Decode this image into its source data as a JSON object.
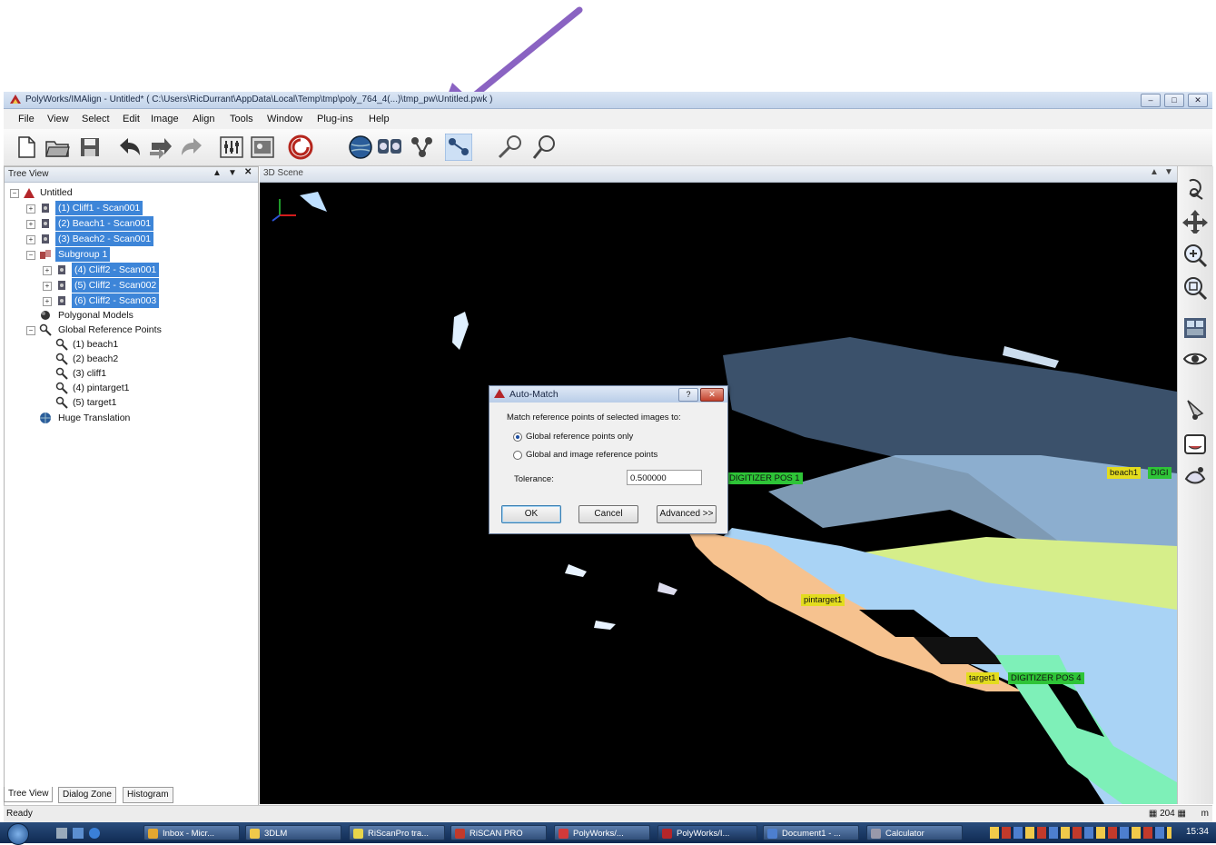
{
  "window": {
    "title": "PolyWorks/IMAlign - Untitled* ( C:\\Users\\RicDurrant\\AppData\\Local\\Temp\\tmp\\poly_764_4(...)\\tmp_pw\\Untitled.pwk )",
    "minimize": "–",
    "maximize": "□",
    "close": "✕"
  },
  "menu": [
    "File",
    "View",
    "Select",
    "Edit",
    "Image",
    "Align",
    "Tools",
    "Window",
    "Plug-ins",
    "Help"
  ],
  "tree_view": {
    "header": "Tree View",
    "root": "Untitled",
    "items": [
      {
        "label": "(1) Cliff1 - Scan001",
        "selected": true
      },
      {
        "label": "(2) Beach1 - Scan001",
        "selected": true
      },
      {
        "label": "(3) Beach2 - Scan001",
        "selected": true
      },
      {
        "label": "Subgroup 1",
        "selected": true
      },
      {
        "label": "(4) Cliff2 - Scan001",
        "selected": true
      },
      {
        "label": "(5) Cliff2 - Scan002",
        "selected": true
      },
      {
        "label": "(6) Cliff2 - Scan003",
        "selected": true
      },
      {
        "label": "Polygonal Models",
        "selected": false
      },
      {
        "label": "Global Reference Points",
        "selected": false
      },
      {
        "label": "(1) beach1",
        "selected": false
      },
      {
        "label": "(2) beach2",
        "selected": false
      },
      {
        "label": "(3) cliff1",
        "selected": false
      },
      {
        "label": "(4) pintarget1",
        "selected": false
      },
      {
        "label": "(5) target1",
        "selected": false
      },
      {
        "label": "Huge Translation",
        "selected": false
      }
    ],
    "tabs": [
      "Tree View",
      "Dialog Zone",
      "Histogram"
    ]
  },
  "scene": {
    "header": "3D Scene",
    "tags": {
      "digitizer_pos1": "DIGITIZER POS 1",
      "beach1": "beach1",
      "digi": "DIGI",
      "pintarget1": "pintarget1",
      "target1": "target1",
      "digitizer_pos4": "DIGITIZER POS 4"
    }
  },
  "dialog": {
    "title": "Auto-Match",
    "prompt": "Match reference points of selected images to:",
    "option_global": "Global reference points only",
    "option_global_image": "Global and image reference points",
    "selected_option": "global",
    "tolerance_label": "Tolerance:",
    "tolerance_value": "0.500000",
    "ok": "OK",
    "cancel": "Cancel",
    "advanced": "Advanced >>"
  },
  "status": {
    "left": "Ready",
    "count": "204",
    "unit": "m"
  },
  "taskbar": {
    "items": [
      "Inbox - Micr...",
      "3DLM",
      "RiScanPro tra...",
      "RiSCAN PRO",
      "PolyWorks/...",
      "PolyWorks/I...",
      "Document1 - ...",
      "Calculator"
    ],
    "clock": "15:34"
  },
  "colors": {
    "selection": "#3d85d8",
    "annotation_arrow": "#8a63c2",
    "tag_yellow": "#e3dc1e",
    "tag_green": "#2ec437"
  }
}
